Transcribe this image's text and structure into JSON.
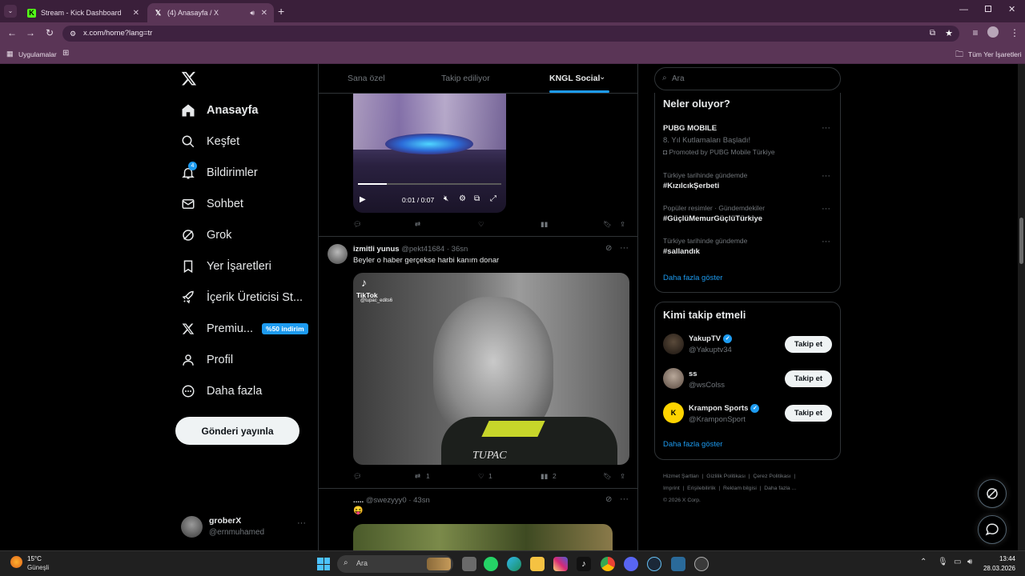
{
  "browser": {
    "tabs": [
      {
        "title": "Stream - Kick Dashboard",
        "icon": "kick-icon"
      },
      {
        "title": "(4) Anasayfa / X",
        "icon": "x-logo-icon"
      }
    ],
    "url": "x.com/home?lang=tr",
    "bookmarks": {
      "apps": "Uygulamalar",
      "all": "Tüm Yer İşaretleri"
    }
  },
  "sidebar": {
    "items": [
      {
        "label": "Anasayfa",
        "icon": "home-icon"
      },
      {
        "label": "Keşfet",
        "icon": "search-icon"
      },
      {
        "label": "Bildirimler",
        "icon": "bell-icon",
        "badge": "4"
      },
      {
        "label": "Sohbet",
        "icon": "mail-icon"
      },
      {
        "label": "Grok",
        "icon": "grok-icon"
      },
      {
        "label": "Yer İşaretleri",
        "icon": "bookmark-icon"
      },
      {
        "label": "İçerik Üreticisi St...",
        "icon": "rocket-icon"
      },
      {
        "label": "Premiu...",
        "icon": "x-logo-icon",
        "badge": "%50 indirim"
      },
      {
        "label": "Profil",
        "icon": "person-icon"
      },
      {
        "label": "Daha fazla",
        "icon": "more-circle-icon"
      }
    ],
    "post_button": "Gönderi yayınla",
    "account": {
      "name": "groberX",
      "handle": "@ernmuhamed"
    }
  },
  "timeline": {
    "tabs": [
      "Sana özel",
      "Takip ediliyor",
      "KNGL Social"
    ],
    "video_time": "0:01 / 0:07",
    "posts": [
      {
        "name": "izmitli yunus",
        "handle": "@pekt41684",
        "time": "36sn",
        "text": "Beyler o haber gerçekse harbi kanım donar",
        "media_watermark": "TikTok",
        "media_handle": "@tupac_edits6",
        "media_caption": "TUPAC",
        "retweets": "1",
        "likes": "1",
        "views": "2"
      },
      {
        "name": ".....",
        "handle": "@swezyyy0",
        "time": "43sn",
        "text": "😝"
      }
    ]
  },
  "right": {
    "search_placeholder": "Ara",
    "trends_title": "Neler oluyor?",
    "trends": [
      {
        "meta": "",
        "title": "PUBG MOBILE",
        "sub": "8. Yıl Kutlamaları Başladı!",
        "promoted": "Promoted by PUBG Mobile Türkiye"
      },
      {
        "meta": "Türkiye tarihinde gündemde",
        "title": "#KızılcıkŞerbeti"
      },
      {
        "meta": "Popüler resimler · Gündemdekiler",
        "title": "#GüçlüMemurGüçlüTürkiye"
      },
      {
        "meta": "Türkiye tarihinde gündemde",
        "title": "#sallandık"
      }
    ],
    "show_more": "Daha fazla göster",
    "who_title": "Kimi takip etmeli",
    "who": [
      {
        "name": "YakupTV",
        "handle": "@Yakuptv34",
        "verified": true
      },
      {
        "name": "ss",
        "handle": "@wsColss",
        "verified": false
      },
      {
        "name": "Krampon Sports",
        "handle": "@KramponSport",
        "verified": true
      }
    ],
    "follow_label": "Takip et",
    "footer": [
      "Hizmet Şartları",
      "Gizlilik Politikası",
      "Çerez Politikası",
      "Imprint",
      "Erişilebilirlik",
      "Reklam bilgisi",
      "Daha fazla ...",
      "© 2026 X Corp."
    ]
  },
  "taskbar": {
    "weather_temp": "15°C",
    "weather_desc": "Güneşli",
    "search": "Ara",
    "time": "13:44",
    "date": "28.03.2026"
  }
}
